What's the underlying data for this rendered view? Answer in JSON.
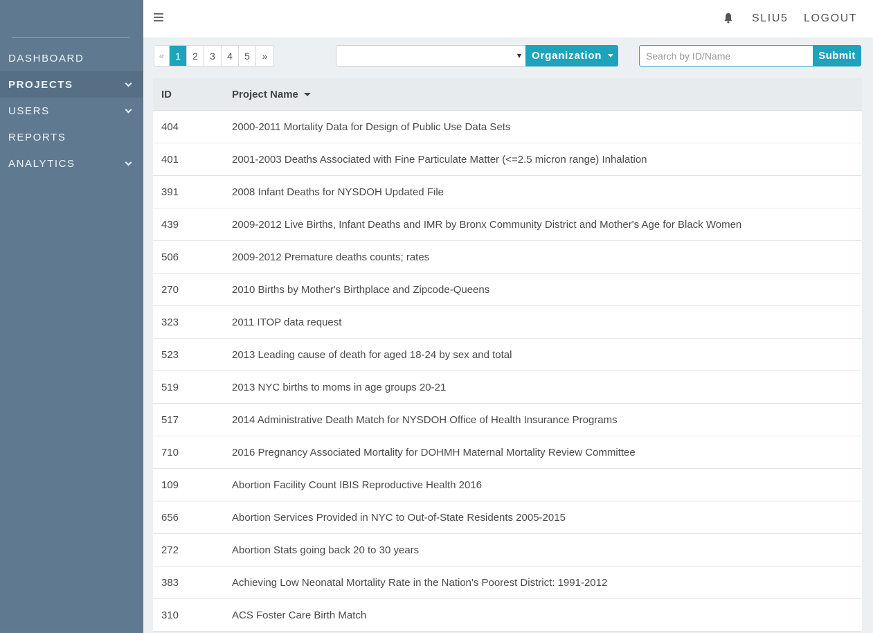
{
  "sidebar": {
    "items": [
      {
        "label": "DASHBOARD",
        "has_chevron": false
      },
      {
        "label": "PROJECTS",
        "has_chevron": true
      },
      {
        "label": "USERS",
        "has_chevron": true
      },
      {
        "label": "REPORTS",
        "has_chevron": false
      },
      {
        "label": "ANALYTICS",
        "has_chevron": true
      }
    ],
    "active_item": "PROJECTS"
  },
  "topbar": {
    "username": "SLIU5",
    "logout_label": "LOGOUT",
    "icons": [
      "hamburger-icon",
      "bell-icon"
    ]
  },
  "pagination": {
    "prev": "«",
    "next": "»",
    "pages": [
      "1",
      "2",
      "3",
      "4",
      "5"
    ],
    "current_page": "1"
  },
  "filter": {
    "selected_value": "",
    "button_label": "Organization"
  },
  "search": {
    "placeholder": "Search by ID/Name",
    "value": "",
    "submit_label": "Submit"
  },
  "table": {
    "headers": {
      "id": "ID",
      "name": "Project Name"
    },
    "sort_column": "Project Name",
    "rows": [
      {
        "id": "404",
        "name": "2000-2011 Mortality Data for Design of Public Use Data Sets"
      },
      {
        "id": "401",
        "name": "2001-2003 Deaths Associated with Fine Particulate Matter (<=2.5 micron range) Inhalation"
      },
      {
        "id": "391",
        "name": "2008 Infant Deaths for NYSDOH Updated File"
      },
      {
        "id": "439",
        "name": "2009-2012 Live Births, Infant Deaths and IMR by Bronx Community District and Mother's Age for Black Women"
      },
      {
        "id": "506",
        "name": "2009-2012 Premature deaths counts; rates"
      },
      {
        "id": "270",
        "name": "2010 Births by Mother's Birthplace and Zipcode-Queens"
      },
      {
        "id": "323",
        "name": "2011 ITOP data request"
      },
      {
        "id": "523",
        "name": "2013 Leading cause of death for aged 18-24 by sex and total"
      },
      {
        "id": "519",
        "name": "2013 NYC births to moms in age groups 20-21"
      },
      {
        "id": "517",
        "name": "2014 Administrative Death Match for NYSDOH Office of Health Insurance Programs"
      },
      {
        "id": "710",
        "name": "2016 Pregnancy Associated Mortality for DOHMH Maternal Mortality Review Committee"
      },
      {
        "id": "109",
        "name": "Abortion Facility Count IBIS Reproductive Health 2016"
      },
      {
        "id": "656",
        "name": "Abortion Services Provided in NYC to Out-of-State Residents 2005-2015"
      },
      {
        "id": "272",
        "name": "Abortion Stats going back 20 to 30 years"
      },
      {
        "id": "383",
        "name": "Achieving Low Neonatal Mortality Rate in the Nation's Poorest District: 1991-2012"
      },
      {
        "id": "310",
        "name": "ACS Foster Care Birth Match"
      }
    ]
  },
  "colors": {
    "sidebar_bg": "#5f7a90",
    "accent": "#1fa3bc",
    "page_bg": "#edf0f3"
  }
}
